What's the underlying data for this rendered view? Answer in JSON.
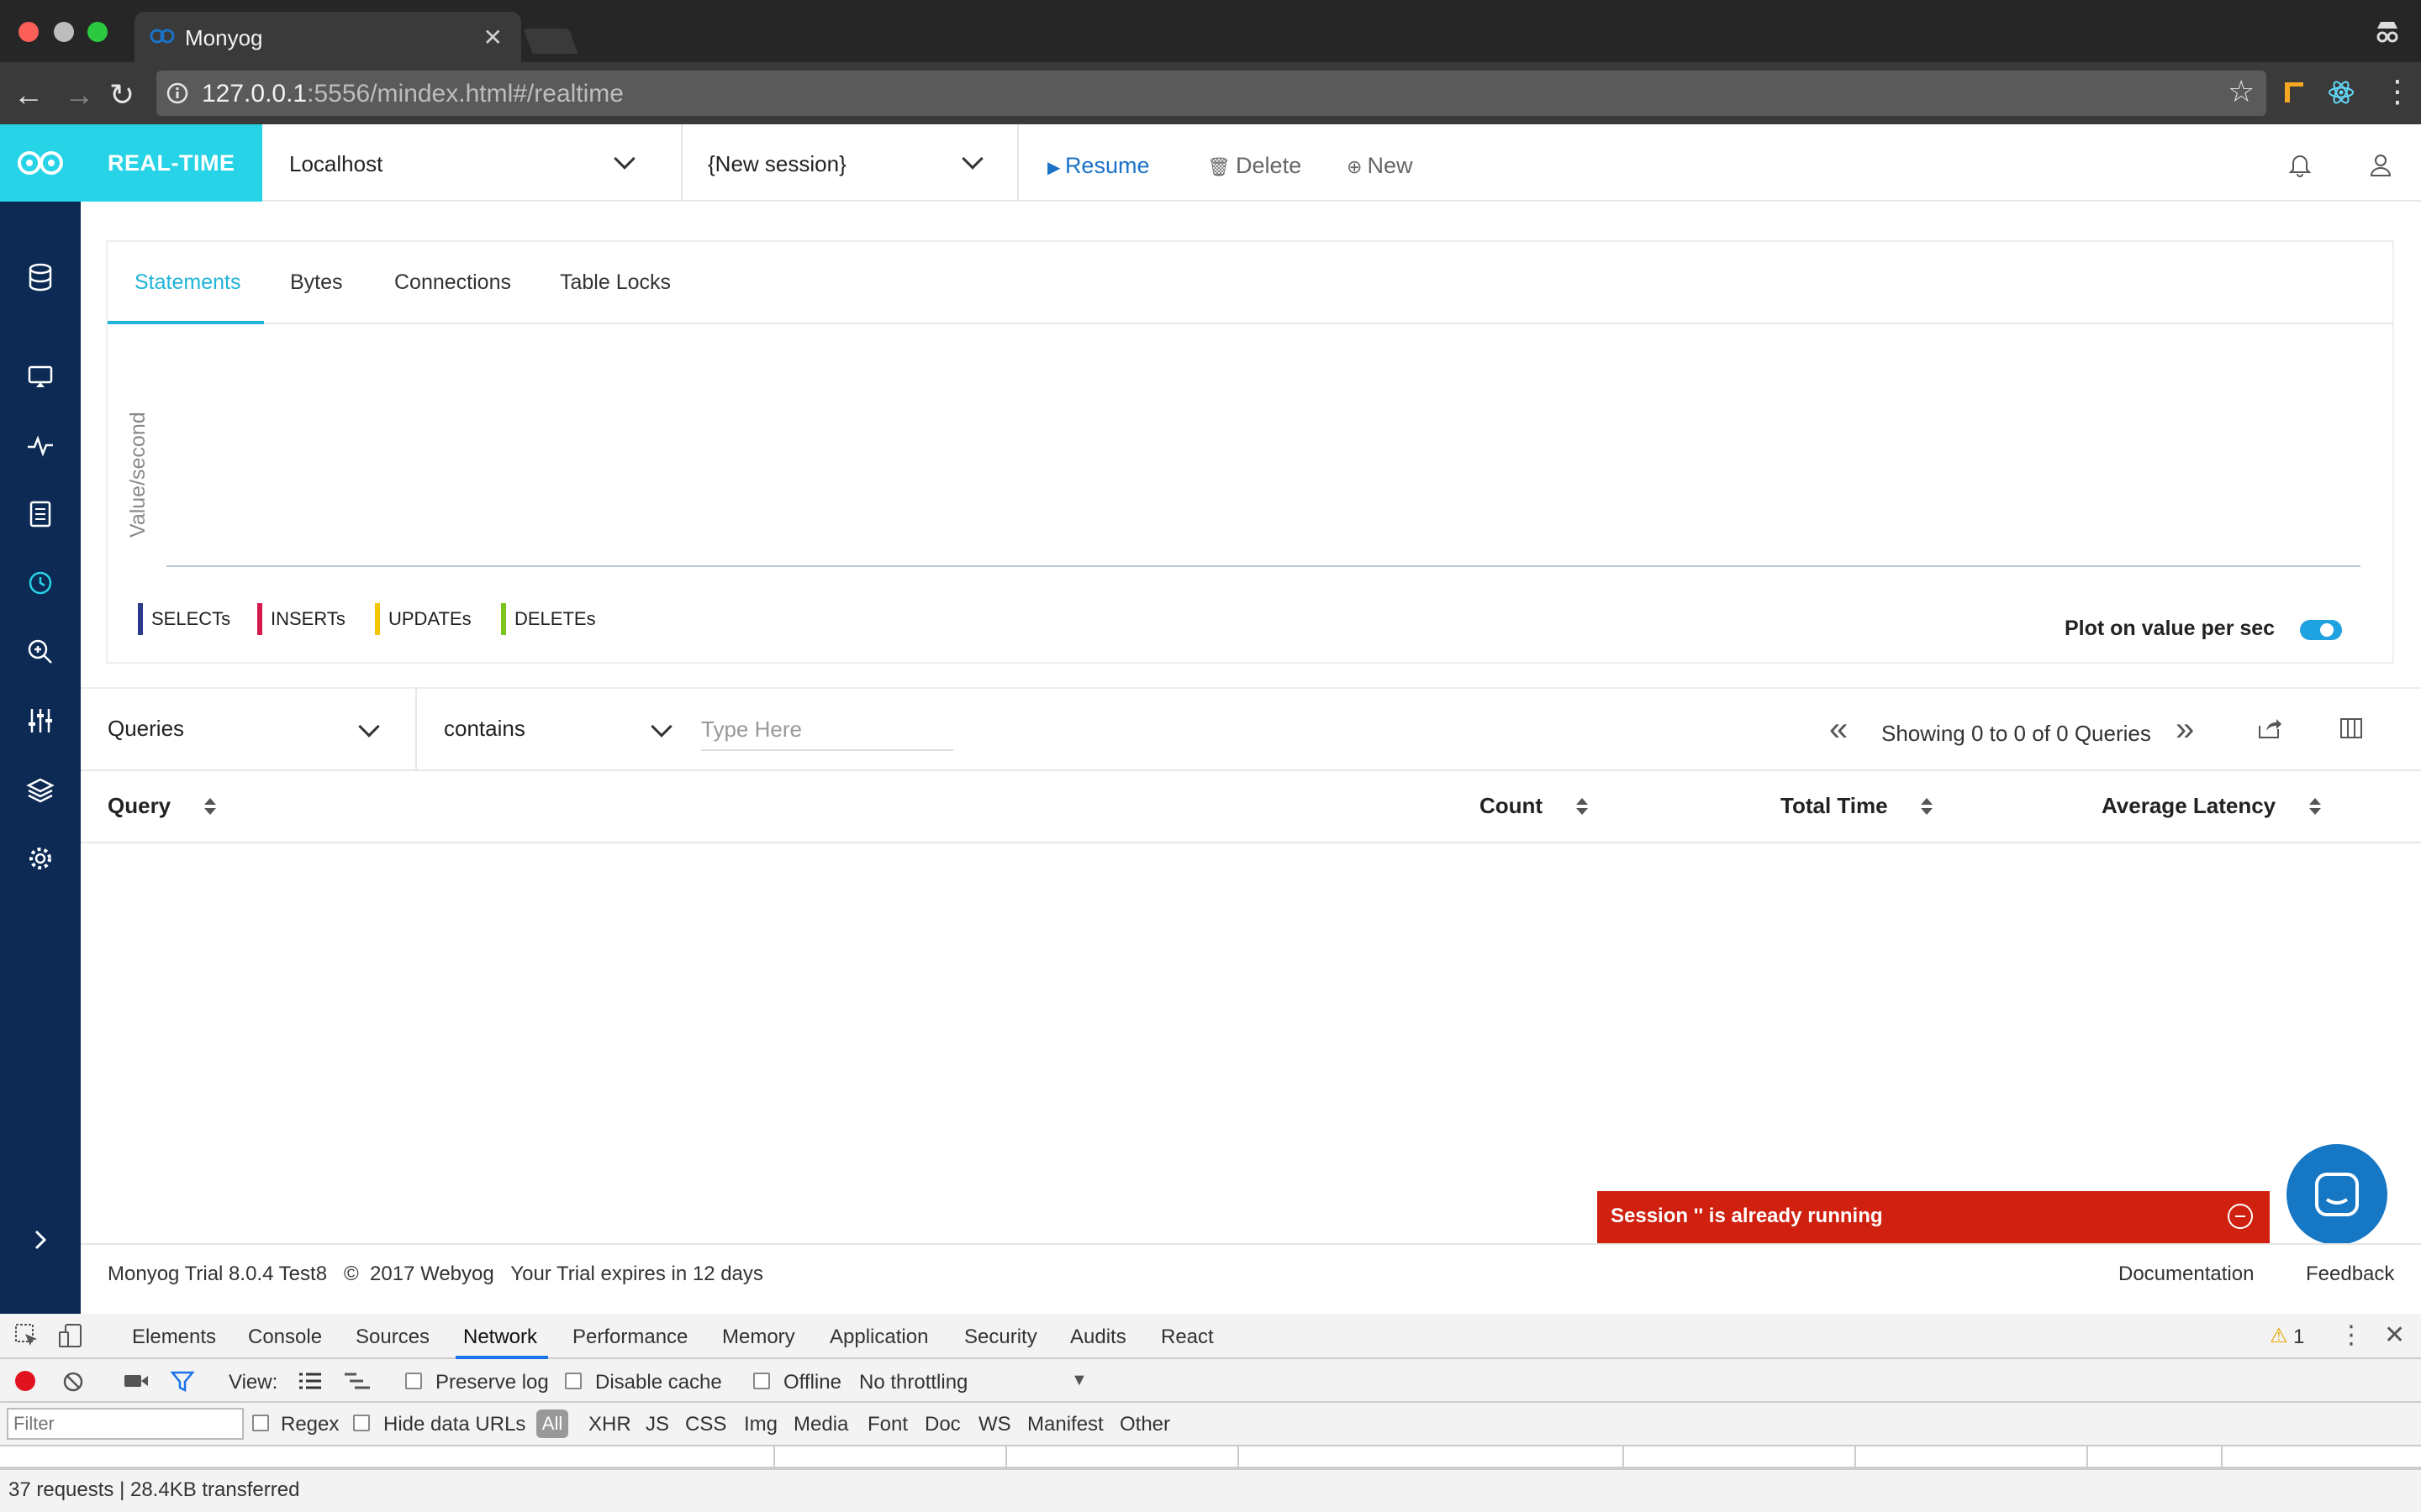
{
  "browser": {
    "tab_title": "Monyog",
    "url_host": "127.0.0.1",
    "url_rest": ":5556/mindex.html#/realtime"
  },
  "header": {
    "brand_label": "REAL-TIME",
    "server_select": "Localhost",
    "session_select": "{New session}",
    "resume_label": "Resume",
    "delete_label": "Delete",
    "new_label": "New"
  },
  "sidebar": {
    "items": [
      "database-icon",
      "monitor-icon",
      "activity-icon",
      "document-icon",
      "clock-icon",
      "zoom-icon",
      "sliders-icon",
      "layers-icon",
      "gear-icon",
      "expand-icon"
    ]
  },
  "chart": {
    "tabs": [
      "Statements",
      "Bytes",
      "Connections",
      "Table Locks"
    ],
    "active_tab": "Statements",
    "ylabel": "Value/second",
    "legend": [
      {
        "label": "SELECTs",
        "color": "#2d3a8c"
      },
      {
        "label": "INSERTs",
        "color": "#d5194f"
      },
      {
        "label": "UPDATEs",
        "color": "#f5c400"
      },
      {
        "label": "DELETEs",
        "color": "#7cc51b"
      }
    ],
    "plot_toggle_label": "Plot on value per sec",
    "plot_toggle_on": true
  },
  "filter": {
    "field": "Queries",
    "operator": "contains",
    "placeholder": "Type Here",
    "showing": "Showing 0 to 0 of 0 Queries"
  },
  "table": {
    "columns": [
      "Query",
      "Count",
      "Total Time",
      "Average Latency"
    ],
    "rows": []
  },
  "toast": {
    "message": "Session '' is already running"
  },
  "footer": {
    "left": "Monyog Trial 8.0.4 Test8   ©  2017 Webyog   Your Trial expires in 12 days",
    "documentation": "Documentation",
    "feedback": "Feedback"
  },
  "devtools": {
    "tabs": [
      "Elements",
      "Console",
      "Sources",
      "Network",
      "Performance",
      "Memory",
      "Application",
      "Security",
      "Audits",
      "React"
    ],
    "active_tab": "Network",
    "warning_count": "1",
    "toolbar": {
      "view_label": "View:",
      "preserve_log": "Preserve log",
      "disable_cache": "Disable cache",
      "offline": "Offline",
      "throttling": "No throttling"
    },
    "filter_placeholder": "Filter",
    "regex": "Regex",
    "hide_data_urls": "Hide data URLs",
    "types": [
      "All",
      "XHR",
      "JS",
      "CSS",
      "Img",
      "Media",
      "Font",
      "Doc",
      "WS",
      "Manifest",
      "Other"
    ],
    "status": "37 requests | 28.4KB transferred"
  }
}
